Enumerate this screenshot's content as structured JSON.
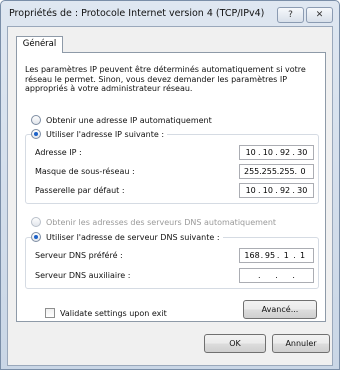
{
  "window": {
    "title": "Propriétés de : Protocole Internet version 4 (TCP/IPv4)",
    "help_label": "?",
    "close_label": "✕"
  },
  "tabs": [
    {
      "label": "Général"
    }
  ],
  "intro_text": "Les paramètres IP peuvent être déterminés automatiquement si votre réseau le permet. Sinon, vous devez demander les paramètres IP appropriés à votre administrateur réseau.",
  "ip": {
    "auto_label": "Obtenir une adresse IP automatiquement",
    "manual_label": "Utiliser l'adresse IP suivante :",
    "selected": "manual",
    "fields": {
      "address": {
        "label": "Adresse IP :",
        "octets": [
          "10",
          "10",
          "92",
          "30"
        ]
      },
      "mask": {
        "label": "Masque de sous-réseau :",
        "octets": [
          "255",
          "255",
          "255",
          "0"
        ]
      },
      "gateway": {
        "label": "Passerelle par défaut :",
        "octets": [
          "10",
          "10",
          "92",
          "30"
        ]
      }
    }
  },
  "dns": {
    "auto_label": "Obtenir les adresses des serveurs DNS automatiquement",
    "manual_label": "Utiliser l'adresse de serveur DNS suivante :",
    "selected": "manual",
    "fields": {
      "preferred": {
        "label": "Serveur DNS préféré :",
        "octets": [
          "168",
          "95",
          "1",
          "1"
        ]
      },
      "alternate": {
        "label": "Serveur DNS auxiliaire :",
        "octets": [
          "",
          "",
          "",
          ""
        ]
      }
    }
  },
  "validate_label": "Validate settings upon exit",
  "advanced_label": "Avancé...",
  "ok_label": "OK",
  "cancel_label": "Annuler",
  "colors": {
    "radio_selected": "#1d62c8",
    "title_bar": "#dfe7f1"
  }
}
